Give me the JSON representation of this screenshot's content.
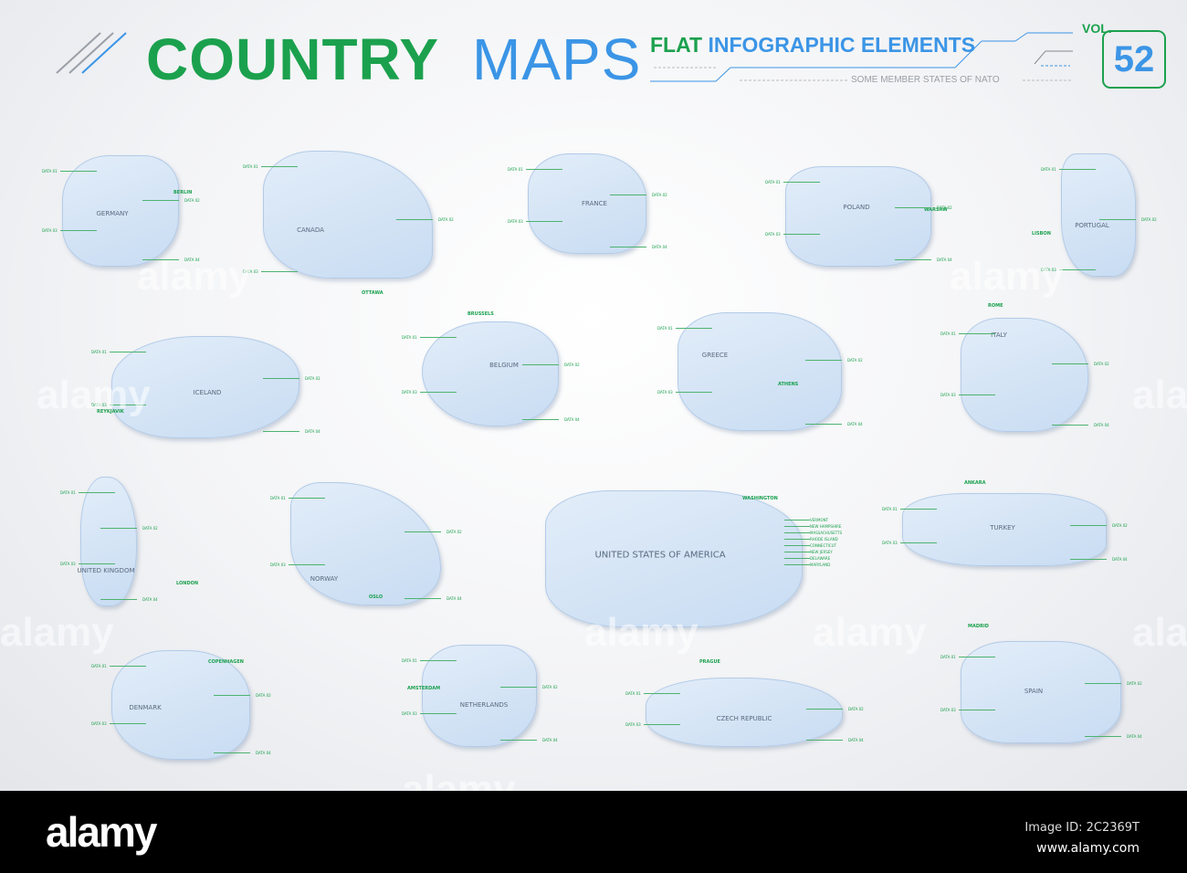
{
  "header": {
    "title_part1": "COUNTRY",
    "title_part2": "MAPS",
    "subtitle_green": "FLAT",
    "subtitle_blue": "INFOGRAPHIC ELEMENTS",
    "tagline": "SOME MEMBER STATES OF NATO",
    "vol_label": "VOL.",
    "vol_number": "52"
  },
  "colors": {
    "green": "#1ba14e",
    "blue": "#3b95e6",
    "map_fill": "#d6e6f7"
  },
  "countries": [
    {
      "name": "GERMANY",
      "capital": "BERLIN",
      "data": [
        "DATA 01",
        "DATA 02",
        "DATA 03",
        "DATA 04"
      ]
    },
    {
      "name": "CANADA",
      "capital": "OTTAWA",
      "data": [
        "DATA 01",
        "DATA 02",
        "DATA 03"
      ]
    },
    {
      "name": "FRANCE",
      "capital": "",
      "data": [
        "DATA 01",
        "DATA 02",
        "DATA 03",
        "DATA 04"
      ]
    },
    {
      "name": "POLAND",
      "capital": "WARSAW",
      "data": [
        "DATA 01",
        "DATA 02",
        "DATA 03",
        "DATA 04"
      ]
    },
    {
      "name": "PORTUGAL",
      "capital": "LISBON",
      "data": [
        "DATA 01",
        "DATA 02",
        "DATA 03"
      ]
    },
    {
      "name": "ICELAND",
      "capital": "REYKJAVIK",
      "data": [
        "DATA 01",
        "DATA 02",
        "DATA 03",
        "DATA 04"
      ]
    },
    {
      "name": "BELGIUM",
      "capital": "BRUSSELS",
      "data": [
        "DATA 01",
        "DATA 02",
        "DATA 03",
        "DATA 04"
      ]
    },
    {
      "name": "GREECE",
      "capital": "ATHENS",
      "data": [
        "DATA 01",
        "DATA 02",
        "DATA 03",
        "DATA 04"
      ]
    },
    {
      "name": "ITALY",
      "capital": "ROME",
      "data": [
        "DATA 01",
        "DATA 02",
        "DATA 03",
        "DATA 04"
      ]
    },
    {
      "name": "UNITED KINGDOM",
      "capital": "LONDON",
      "data": [
        "DATA 01",
        "DATA 02",
        "DATA 03",
        "DATA 04"
      ]
    },
    {
      "name": "NORWAY",
      "capital": "OSLO",
      "data": [
        "DATA 01",
        "DATA 02",
        "DATA 03",
        "DATA 04"
      ]
    },
    {
      "name": "UNITED STATES OF AMERICA",
      "capital": "WASHINGTON",
      "data": [
        "VERMONT",
        "NEW HAMPSHIRE",
        "MASSACHUSETTS",
        "RHODE ISLAND",
        "CONNECTICUT",
        "NEW JERSEY",
        "DELAWARE",
        "MARYLAND"
      ]
    },
    {
      "name": "TURKEY",
      "capital": "ANKARA",
      "data": [
        "DATA 01",
        "DATA 02",
        "DATA 03",
        "DATA 04"
      ]
    },
    {
      "name": "DENMARK",
      "capital": "COPENHAGEN",
      "data": [
        "DATA 01",
        "DATA 02",
        "DATA 03",
        "DATA 04"
      ]
    },
    {
      "name": "NETHERLANDS",
      "capital": "AMSTERDAM",
      "data": [
        "DATA 01",
        "DATA 02",
        "DATA 03",
        "DATA 04"
      ]
    },
    {
      "name": "CZECH REPUBLIC",
      "capital": "PRAGUE",
      "data": [
        "DATA 01",
        "DATA 02",
        "DATA 03",
        "DATA 04"
      ]
    },
    {
      "name": "SPAIN",
      "capital": "MADRID",
      "data": [
        "DATA 01",
        "DATA 02",
        "DATA 03",
        "DATA 04"
      ]
    }
  ],
  "watermark": "alamy",
  "footer": {
    "logo": "alamy",
    "image_id": "Image ID: 2C2369T",
    "url": "www.alamy.com"
  }
}
